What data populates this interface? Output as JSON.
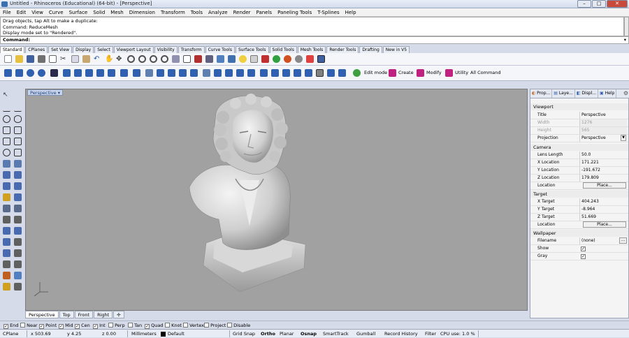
{
  "window": {
    "title": "Untitled - Rhinoceros (Educational) (64-bit) - [Perspective]"
  },
  "menu": [
    "File",
    "Edit",
    "View",
    "Curve",
    "Surface",
    "Solid",
    "Mesh",
    "Dimension",
    "Transform",
    "Tools",
    "Analyze",
    "Render",
    "Panels",
    "Paneling Tools",
    "T-Splines",
    "Help"
  ],
  "command_history": [
    "Drag objects, tap Alt to make a duplicate:",
    "Command: ReduceMesh",
    "Display mode set to \"Rendered\"."
  ],
  "command_prompt": "Command:",
  "toolbar_tabs": [
    "Standard",
    "CPlanes",
    "Set View",
    "Display",
    "Select",
    "Viewport Layout",
    "Visibility",
    "Transform",
    "Curve Tools",
    "Surface Tools",
    "Solid Tools",
    "Mesh Tools",
    "Render Tools",
    "Drafting",
    "New in V5"
  ],
  "tsplines": {
    "edit_mode": "Edit mode",
    "create": "Create",
    "modify": "Modify",
    "utility": "Utility",
    "all_command": "All Command"
  },
  "viewport": {
    "label": "Perspective"
  },
  "viewport_tabs": [
    "Perspective",
    "Top",
    "Front",
    "Right"
  ],
  "panel": {
    "tabs": [
      "Prop...",
      "Laye...",
      "Displ...",
      "Help"
    ],
    "viewport_section": "Viewport",
    "title_label": "Title",
    "title_value": "Perspective",
    "width_label": "Width",
    "width_value": "1276",
    "height_label": "Height",
    "height_value": "565",
    "projection_label": "Projection",
    "projection_value": "Perspective",
    "camera_section": "Camera",
    "lens_label": "Lens Length",
    "lens_value": "50.0",
    "xloc_label": "X Location",
    "xloc_value": "171.221",
    "yloc_label": "Y Location",
    "yloc_value": "-191.672",
    "zloc_label": "Z Location",
    "zloc_value": "179.809",
    "location_label": "Location",
    "place_button": "Place...",
    "target_section": "Target",
    "xt_label": "X Target",
    "xt_value": "404.243",
    "yt_label": "Y Target",
    "yt_value": "-8.964",
    "zt_label": "Z Target",
    "zt_value": "51.669",
    "tloc_label": "Location",
    "wallpaper_section": "Wallpaper",
    "filename_label": "Filename",
    "filename_value": "(none)",
    "show_label": "Show",
    "gray_label": "Gray"
  },
  "osnap": [
    {
      "label": "End",
      "checked": true
    },
    {
      "label": "Near",
      "checked": false
    },
    {
      "label": "Point",
      "checked": true
    },
    {
      "label": "Mid",
      "checked": true
    },
    {
      "label": "Cen",
      "checked": true
    },
    {
      "label": "Int",
      "checked": true
    },
    {
      "label": "Perp",
      "checked": false
    },
    {
      "label": "Tan",
      "checked": false
    },
    {
      "label": "Quad",
      "checked": true
    },
    {
      "label": "Knot",
      "checked": false
    },
    {
      "label": "Vertex",
      "checked": false
    },
    {
      "label": "Project",
      "checked": false
    },
    {
      "label": "Disable",
      "checked": false
    }
  ],
  "status": {
    "cplane": "CPlane",
    "x": "x 503.69",
    "y": "y 4.25",
    "z": "z 0.00",
    "units": "Millimeters",
    "layer": "Default",
    "grid_snap": "Grid Snap",
    "ortho": "Ortho",
    "planar": "Planar",
    "osnap": "Osnap",
    "smarttrack": "SmartTrack",
    "gumball": "Gumball",
    "record_history": "Record History",
    "filter": "Filter",
    "cpu": "CPU use: 1.0 %"
  },
  "colors": {
    "accent": "#3a6fb0",
    "viewport_bg": "#a1a1a1"
  }
}
